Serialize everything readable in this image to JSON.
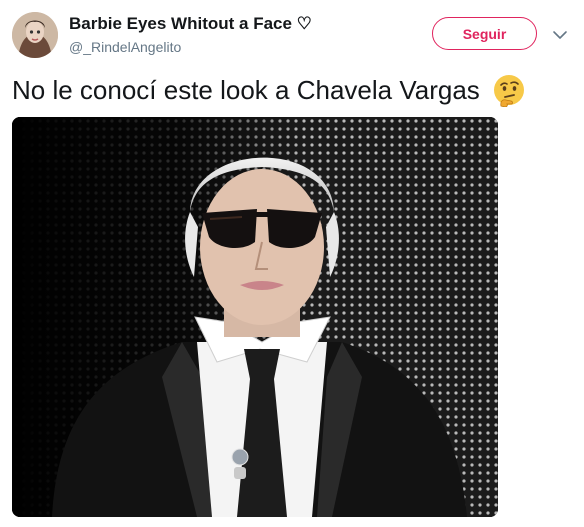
{
  "tweet": {
    "author_name": "Barbie Eyes Whitout a Face ♡",
    "author_handle": "@_RindelAngelito",
    "follow_label": "Seguir",
    "text": "No le conocí este look a Chavela Vargas"
  },
  "icons": {
    "menu": "chevron-down-icon",
    "emoji": "thinking-face-icon"
  },
  "colors": {
    "accent": "#e0245e",
    "handle": "#657786",
    "text": "#14171a"
  }
}
